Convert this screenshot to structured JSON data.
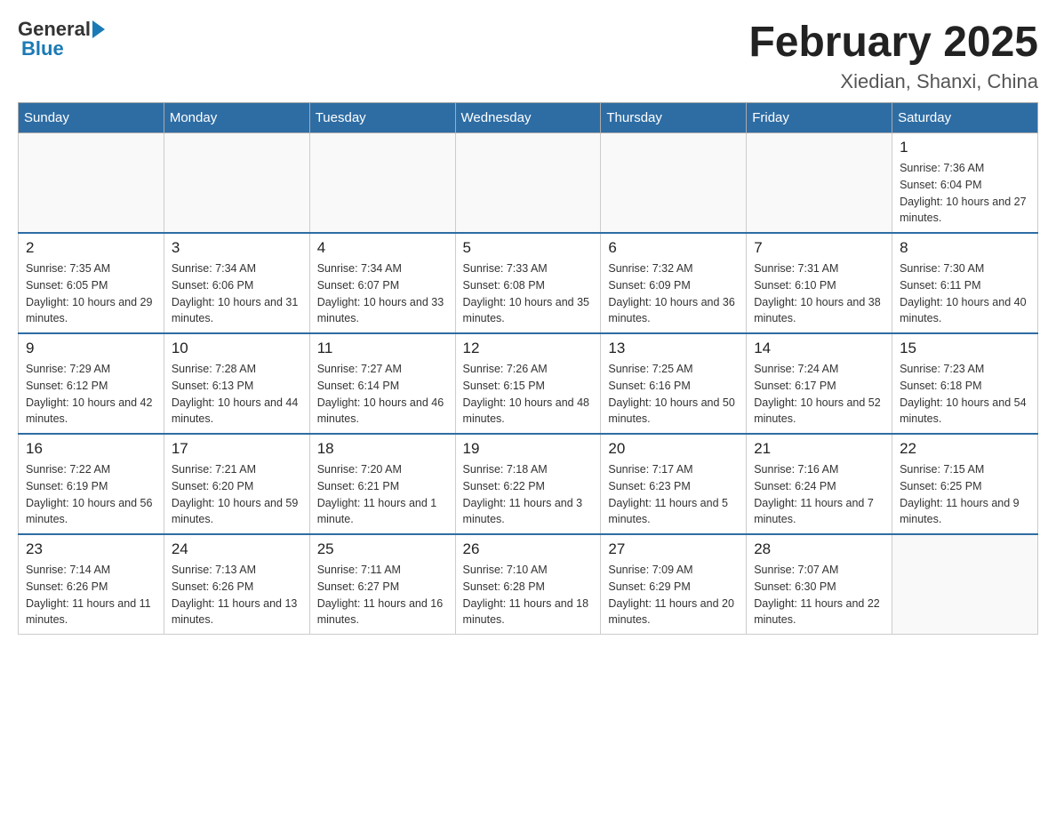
{
  "header": {
    "logo_general": "General",
    "logo_blue": "Blue",
    "month_title": "February 2025",
    "location": "Xiedian, Shanxi, China"
  },
  "weekdays": [
    "Sunday",
    "Monday",
    "Tuesday",
    "Wednesday",
    "Thursday",
    "Friday",
    "Saturday"
  ],
  "weeks": [
    [
      {
        "day": "",
        "sunrise": "",
        "sunset": "",
        "daylight": ""
      },
      {
        "day": "",
        "sunrise": "",
        "sunset": "",
        "daylight": ""
      },
      {
        "day": "",
        "sunrise": "",
        "sunset": "",
        "daylight": ""
      },
      {
        "day": "",
        "sunrise": "",
        "sunset": "",
        "daylight": ""
      },
      {
        "day": "",
        "sunrise": "",
        "sunset": "",
        "daylight": ""
      },
      {
        "day": "",
        "sunrise": "",
        "sunset": "",
        "daylight": ""
      },
      {
        "day": "1",
        "sunrise": "Sunrise: 7:36 AM",
        "sunset": "Sunset: 6:04 PM",
        "daylight": "Daylight: 10 hours and 27 minutes."
      }
    ],
    [
      {
        "day": "2",
        "sunrise": "Sunrise: 7:35 AM",
        "sunset": "Sunset: 6:05 PM",
        "daylight": "Daylight: 10 hours and 29 minutes."
      },
      {
        "day": "3",
        "sunrise": "Sunrise: 7:34 AM",
        "sunset": "Sunset: 6:06 PM",
        "daylight": "Daylight: 10 hours and 31 minutes."
      },
      {
        "day": "4",
        "sunrise": "Sunrise: 7:34 AM",
        "sunset": "Sunset: 6:07 PM",
        "daylight": "Daylight: 10 hours and 33 minutes."
      },
      {
        "day": "5",
        "sunrise": "Sunrise: 7:33 AM",
        "sunset": "Sunset: 6:08 PM",
        "daylight": "Daylight: 10 hours and 35 minutes."
      },
      {
        "day": "6",
        "sunrise": "Sunrise: 7:32 AM",
        "sunset": "Sunset: 6:09 PM",
        "daylight": "Daylight: 10 hours and 36 minutes."
      },
      {
        "day": "7",
        "sunrise": "Sunrise: 7:31 AM",
        "sunset": "Sunset: 6:10 PM",
        "daylight": "Daylight: 10 hours and 38 minutes."
      },
      {
        "day": "8",
        "sunrise": "Sunrise: 7:30 AM",
        "sunset": "Sunset: 6:11 PM",
        "daylight": "Daylight: 10 hours and 40 minutes."
      }
    ],
    [
      {
        "day": "9",
        "sunrise": "Sunrise: 7:29 AM",
        "sunset": "Sunset: 6:12 PM",
        "daylight": "Daylight: 10 hours and 42 minutes."
      },
      {
        "day": "10",
        "sunrise": "Sunrise: 7:28 AM",
        "sunset": "Sunset: 6:13 PM",
        "daylight": "Daylight: 10 hours and 44 minutes."
      },
      {
        "day": "11",
        "sunrise": "Sunrise: 7:27 AM",
        "sunset": "Sunset: 6:14 PM",
        "daylight": "Daylight: 10 hours and 46 minutes."
      },
      {
        "day": "12",
        "sunrise": "Sunrise: 7:26 AM",
        "sunset": "Sunset: 6:15 PM",
        "daylight": "Daylight: 10 hours and 48 minutes."
      },
      {
        "day": "13",
        "sunrise": "Sunrise: 7:25 AM",
        "sunset": "Sunset: 6:16 PM",
        "daylight": "Daylight: 10 hours and 50 minutes."
      },
      {
        "day": "14",
        "sunrise": "Sunrise: 7:24 AM",
        "sunset": "Sunset: 6:17 PM",
        "daylight": "Daylight: 10 hours and 52 minutes."
      },
      {
        "day": "15",
        "sunrise": "Sunrise: 7:23 AM",
        "sunset": "Sunset: 6:18 PM",
        "daylight": "Daylight: 10 hours and 54 minutes."
      }
    ],
    [
      {
        "day": "16",
        "sunrise": "Sunrise: 7:22 AM",
        "sunset": "Sunset: 6:19 PM",
        "daylight": "Daylight: 10 hours and 56 minutes."
      },
      {
        "day": "17",
        "sunrise": "Sunrise: 7:21 AM",
        "sunset": "Sunset: 6:20 PM",
        "daylight": "Daylight: 10 hours and 59 minutes."
      },
      {
        "day": "18",
        "sunrise": "Sunrise: 7:20 AM",
        "sunset": "Sunset: 6:21 PM",
        "daylight": "Daylight: 11 hours and 1 minute."
      },
      {
        "day": "19",
        "sunrise": "Sunrise: 7:18 AM",
        "sunset": "Sunset: 6:22 PM",
        "daylight": "Daylight: 11 hours and 3 minutes."
      },
      {
        "day": "20",
        "sunrise": "Sunrise: 7:17 AM",
        "sunset": "Sunset: 6:23 PM",
        "daylight": "Daylight: 11 hours and 5 minutes."
      },
      {
        "day": "21",
        "sunrise": "Sunrise: 7:16 AM",
        "sunset": "Sunset: 6:24 PM",
        "daylight": "Daylight: 11 hours and 7 minutes."
      },
      {
        "day": "22",
        "sunrise": "Sunrise: 7:15 AM",
        "sunset": "Sunset: 6:25 PM",
        "daylight": "Daylight: 11 hours and 9 minutes."
      }
    ],
    [
      {
        "day": "23",
        "sunrise": "Sunrise: 7:14 AM",
        "sunset": "Sunset: 6:26 PM",
        "daylight": "Daylight: 11 hours and 11 minutes."
      },
      {
        "day": "24",
        "sunrise": "Sunrise: 7:13 AM",
        "sunset": "Sunset: 6:26 PM",
        "daylight": "Daylight: 11 hours and 13 minutes."
      },
      {
        "day": "25",
        "sunrise": "Sunrise: 7:11 AM",
        "sunset": "Sunset: 6:27 PM",
        "daylight": "Daylight: 11 hours and 16 minutes."
      },
      {
        "day": "26",
        "sunrise": "Sunrise: 7:10 AM",
        "sunset": "Sunset: 6:28 PM",
        "daylight": "Daylight: 11 hours and 18 minutes."
      },
      {
        "day": "27",
        "sunrise": "Sunrise: 7:09 AM",
        "sunset": "Sunset: 6:29 PM",
        "daylight": "Daylight: 11 hours and 20 minutes."
      },
      {
        "day": "28",
        "sunrise": "Sunrise: 7:07 AM",
        "sunset": "Sunset: 6:30 PM",
        "daylight": "Daylight: 11 hours and 22 minutes."
      },
      {
        "day": "",
        "sunrise": "",
        "sunset": "",
        "daylight": ""
      }
    ]
  ]
}
